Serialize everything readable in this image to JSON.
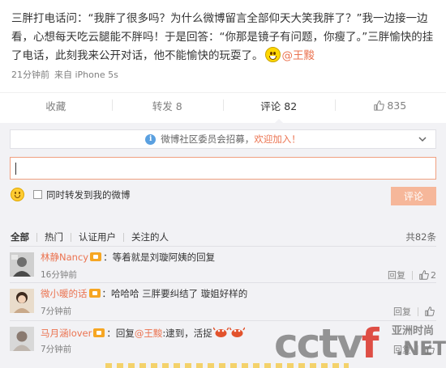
{
  "post": {
    "text_1": "三胖打电话问：“我胖了很多吗？为什么微博留言全部仰天大笑我胖了？”我一边接一边看，心想每天吃云腿能不胖吗！于是回答：“你那是镜子有问题，你瘦了。”三胖愉快的挂了电话，此刻我来公开对话，他不能愉快的玩耍了。",
    "emoji": "grin-emoji",
    "mention": "@王黢",
    "time": "21分钟前",
    "source": "来自 iPhone 5s"
  },
  "actions": {
    "favorite": "收藏",
    "repost": "转发 8",
    "comment": "评论 82",
    "like_count": "835"
  },
  "panel": {
    "notice_text": "微博社区委员会招募，",
    "notice_link": "欢迎加入！",
    "input_value": "",
    "repost_label": "同时转发到我的微博",
    "submit_label": "评论",
    "filters": [
      "全部",
      "热门",
      "认证用户",
      "关注的人"
    ],
    "total": "共82条"
  },
  "comments": [
    {
      "user": "林静Nancy",
      "text": "：等着就是刘璇阿姨的回复",
      "time": "16分钟前",
      "reply": "回复",
      "likes": "2"
    },
    {
      "user": "微小暖的话",
      "text": "：哈哈哈 三胖要纠结了 璇姐好样的",
      "time": "7分钟前",
      "reply": "回复",
      "likes": ""
    },
    {
      "user": "马月涵lover",
      "text_pre": "：回复",
      "mention": "@王黢",
      "text_post": ":逮到，活捉",
      "time": "7分钟前",
      "reply": "回复",
      "likes": ""
    }
  ],
  "watermark": {
    "brand": "cctv",
    "brand_f": "f",
    "brand_net": ".NET",
    "cn": "亚洲时尚"
  },
  "colors": {
    "accent": "#eb7350",
    "panel_bg": "#f2f2f5",
    "submit_disabled": "#f6b79a"
  }
}
